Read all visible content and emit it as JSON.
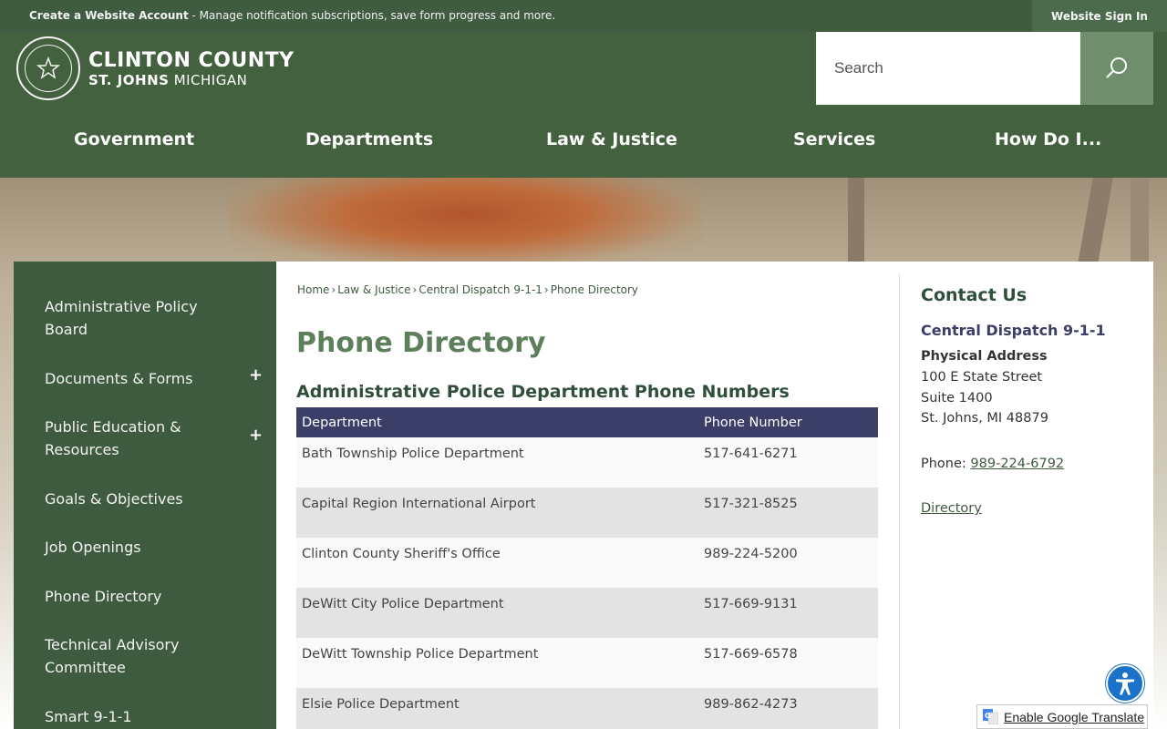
{
  "topbar": {
    "create_bold": "Create a Website Account",
    "create_rest": " - Manage notification subscriptions, save form progress and more.",
    "signin": "Website Sign In"
  },
  "brand": {
    "county": "CLINTON COUNTY",
    "city": "ST. JOHNS",
    "state": " MICHIGAN",
    "seal_icon": "county-seal"
  },
  "search": {
    "placeholder": "Search",
    "icon": "search-icon"
  },
  "nav": [
    "Government",
    "Departments",
    "Law & Justice",
    "Services",
    "How Do I..."
  ],
  "sidebar": {
    "items": [
      {
        "label": "Administrative Policy Board",
        "expandable": false
      },
      {
        "label": "Documents & Forms",
        "expandable": true
      },
      {
        "label": "Public Education & Resources",
        "expandable": true
      },
      {
        "label": "Goals & Objectives",
        "expandable": false
      },
      {
        "label": "Job Openings",
        "expandable": false
      },
      {
        "label": "Phone Directory",
        "expandable": false
      },
      {
        "label": "Technical Advisory Committee",
        "expandable": false
      },
      {
        "label": "Smart 9-1-1",
        "expandable": false
      }
    ],
    "expand_symbol": "+"
  },
  "breadcrumb": [
    "Home",
    "Law & Justice",
    "Central Dispatch 9-1-1",
    "Phone Directory"
  ],
  "breadcrumb_sep": "›",
  "page_title": "Phone Directory",
  "section_heading": "Administrative Police Department Phone Numbers",
  "table": {
    "headers": [
      "Department",
      "Phone Number"
    ],
    "rows": [
      [
        "Bath Township Police Department",
        "517-641-6271"
      ],
      [
        "Capital Region International Airport",
        "517-321-8525"
      ],
      [
        "Clinton County Sheriff's Office",
        "989-224-5200"
      ],
      [
        "DeWitt City Police Department",
        "517-669-9131"
      ],
      [
        "DeWitt Township Police Department",
        "517-669-6578"
      ],
      [
        "Elsie Police Department",
        "989-862-4273"
      ]
    ]
  },
  "contact": {
    "title": "Contact Us",
    "org": "Central Dispatch 9-1-1",
    "address_label": "Physical Address",
    "address": [
      "100 E State Street",
      "Suite 1400",
      "St. Johns, MI 48879"
    ],
    "phone_label": "Phone: ",
    "phone": "989-224-6792",
    "directory": "Directory"
  },
  "translate": {
    "label": "Enable Google Translate",
    "icon": "google-translate-icon"
  },
  "accessibility": {
    "icon": "accessibility-icon"
  },
  "colors": {
    "header_green": "#44613f",
    "sidebar_green": "#3f5b3f",
    "title_green": "#5d7f5b",
    "table_header": "#3b3f67"
  }
}
